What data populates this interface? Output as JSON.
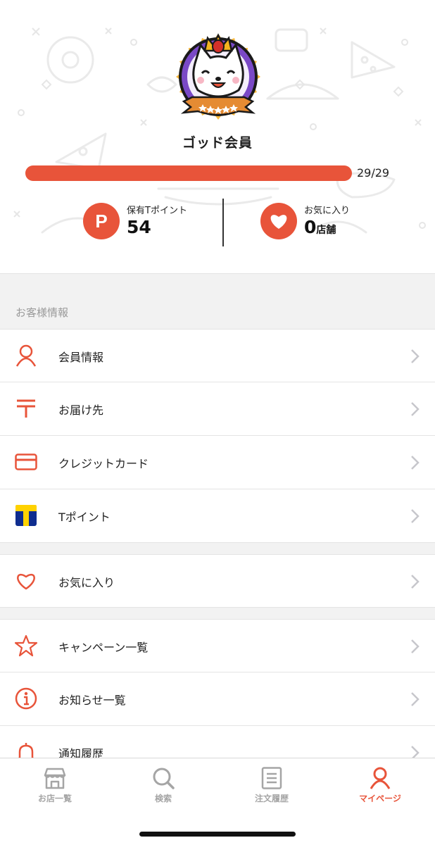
{
  "profile": {
    "rank_label": "ゴッド会員",
    "progress_text": "29/29",
    "progress_fraction": 1.0,
    "avatar_icon": "crowned-cat-badge"
  },
  "stats": {
    "points": {
      "icon_letter": "P",
      "caption": "保有Tポイント",
      "value": "54"
    },
    "favorites": {
      "caption": "お気に入り",
      "value": "0",
      "unit": "店舗"
    }
  },
  "customer_section": {
    "title": "お客様情報",
    "items": [
      {
        "label": "会員情報",
        "icon": "person-icon"
      },
      {
        "label": "お届け先",
        "icon": "postal-mark-icon"
      },
      {
        "label": "クレジットカード",
        "icon": "credit-card-icon"
      },
      {
        "label": "Tポイント",
        "icon": "tpoint-logo-icon"
      }
    ]
  },
  "favorites_section": {
    "items": [
      {
        "label": "お気に入り",
        "icon": "heart-icon"
      }
    ]
  },
  "info_section": {
    "items": [
      {
        "label": "キャンペーン一覧",
        "icon": "star-icon"
      },
      {
        "label": "お知らせ一覧",
        "icon": "info-icon"
      },
      {
        "label": "通知履歴",
        "icon": "bell-icon"
      }
    ]
  },
  "tabbar": {
    "tabs": [
      {
        "label": "お店一覧",
        "icon": "store-icon",
        "active": false
      },
      {
        "label": "検索",
        "icon": "search-icon",
        "active": false
      },
      {
        "label": "注文履歴",
        "icon": "order-history-icon",
        "active": false
      },
      {
        "label": "マイページ",
        "icon": "person-icon",
        "active": true
      }
    ]
  },
  "colors": {
    "accent": "#e8543a",
    "muted": "#a5a5a5",
    "tpoint_blue": "#0f2d8f",
    "tpoint_yellow": "#ffd200"
  }
}
